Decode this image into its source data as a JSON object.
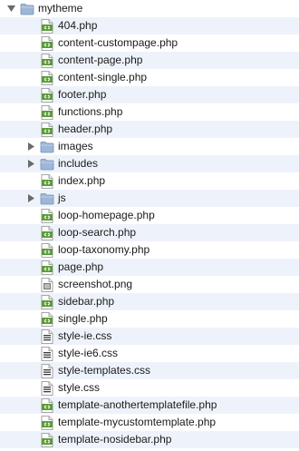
{
  "tree": {
    "root": {
      "label": "mytheme",
      "icon": "folder-icon",
      "expanded": true
    },
    "items": [
      {
        "label": "404.php",
        "type": "file",
        "icon": "php-file-icon"
      },
      {
        "label": "content-custompage.php",
        "type": "file",
        "icon": "php-file-icon"
      },
      {
        "label": "content-page.php",
        "type": "file",
        "icon": "php-file-icon"
      },
      {
        "label": "content-single.php",
        "type": "file",
        "icon": "php-file-icon"
      },
      {
        "label": "footer.php",
        "type": "file",
        "icon": "php-file-icon"
      },
      {
        "label": "functions.php",
        "type": "file",
        "icon": "php-file-icon"
      },
      {
        "label": "header.php",
        "type": "file",
        "icon": "php-file-icon"
      },
      {
        "label": "images",
        "type": "folder",
        "icon": "folder-icon",
        "expanded": false
      },
      {
        "label": "includes",
        "type": "folder",
        "icon": "folder-icon",
        "expanded": false
      },
      {
        "label": "index.php",
        "type": "file",
        "icon": "php-file-icon"
      },
      {
        "label": "js",
        "type": "folder",
        "icon": "folder-icon",
        "expanded": false
      },
      {
        "label": "loop-homepage.php",
        "type": "file",
        "icon": "php-file-icon"
      },
      {
        "label": "loop-search.php",
        "type": "file",
        "icon": "php-file-icon"
      },
      {
        "label": "loop-taxonomy.php",
        "type": "file",
        "icon": "php-file-icon"
      },
      {
        "label": "page.php",
        "type": "file",
        "icon": "php-file-icon"
      },
      {
        "label": "screenshot.png",
        "type": "file",
        "icon": "image-file-icon"
      },
      {
        "label": "sidebar.php",
        "type": "file",
        "icon": "php-file-icon"
      },
      {
        "label": "single.php",
        "type": "file",
        "icon": "php-file-icon"
      },
      {
        "label": "style-ie.css",
        "type": "file",
        "icon": "css-file-icon"
      },
      {
        "label": "style-ie6.css",
        "type": "file",
        "icon": "css-file-icon"
      },
      {
        "label": "style-templates.css",
        "type": "file",
        "icon": "css-file-icon"
      },
      {
        "label": "style.css",
        "type": "file",
        "icon": "css-file-icon"
      },
      {
        "label": "template-anothertemplatefile.php",
        "type": "file",
        "icon": "php-file-icon"
      },
      {
        "label": "template-mycustomtemplate.php",
        "type": "file",
        "icon": "php-file-icon"
      },
      {
        "label": "template-nosidebar.php",
        "type": "file",
        "icon": "php-file-icon"
      }
    ]
  },
  "colors": {
    "row_alt": "#eef3fb",
    "folder_fill": "#9fb7d6",
    "folder_stroke": "#6f8fb8",
    "file_green": "#5c9a3a",
    "disclosure": "#6b6b6b"
  }
}
